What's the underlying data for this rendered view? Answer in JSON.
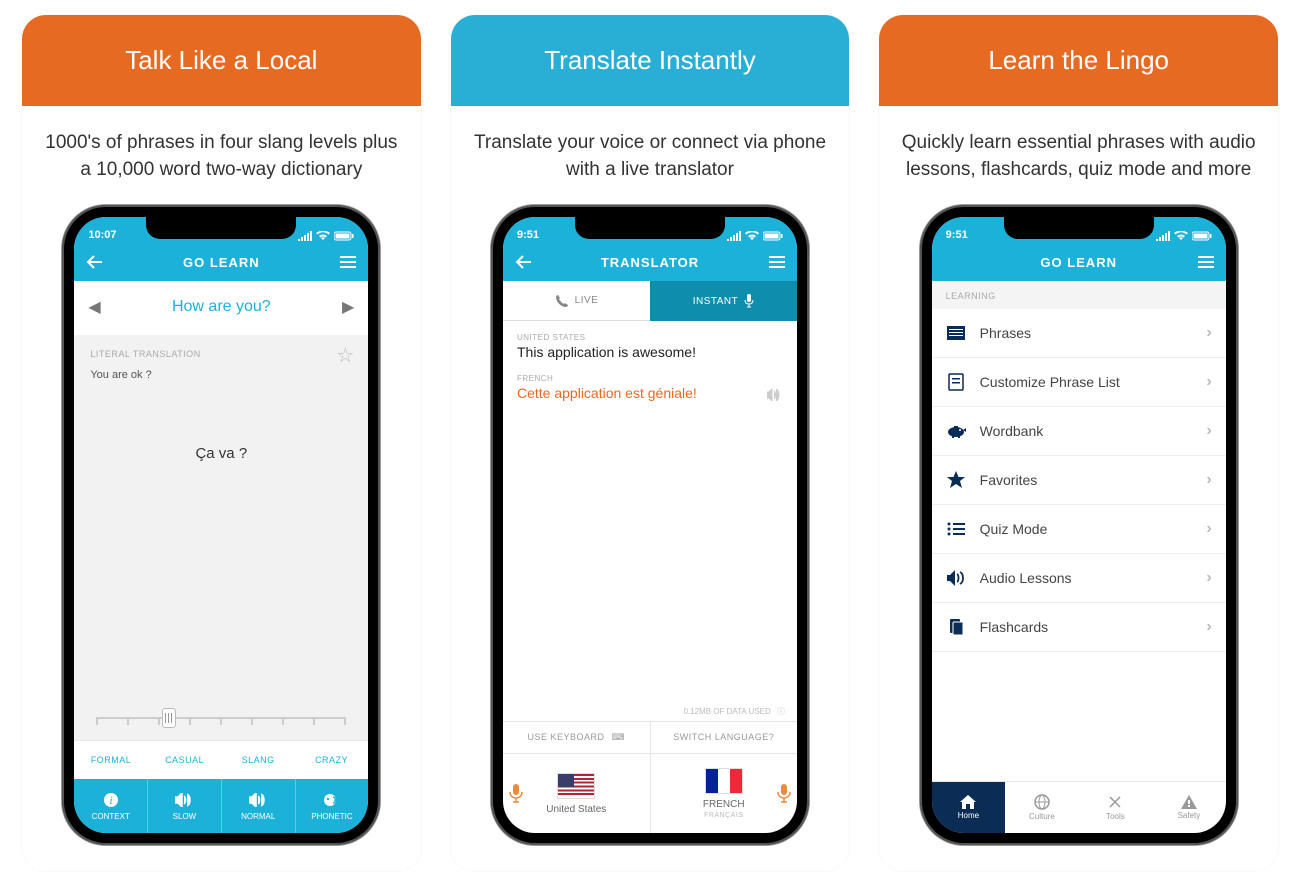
{
  "cards": [
    {
      "title": "Talk Like a Local",
      "subtitle": "1000's of phrases in four slang levels plus a 10,000 word two-way dictionary",
      "header_color": "orange"
    },
    {
      "title": "Translate Instantly",
      "subtitle": "Translate your voice or connect via phone with a live translator",
      "header_color": "teal"
    },
    {
      "title": "Learn the Lingo",
      "subtitle": "Quickly learn essential phrases with audio lessons, flashcards, quiz mode and more",
      "header_color": "orange"
    }
  ],
  "screen1": {
    "time": "10:07",
    "nav_title": "GO LEARN",
    "phrase": "How are you?",
    "literal_label": "LITERAL TRANSLATION",
    "literal_text": "You are ok ?",
    "main_phrase": "Ça va ?",
    "slang_levels": [
      "FORMAL",
      "CASUAL",
      "SLANG",
      "CRAZY"
    ],
    "actions": [
      "CONTEXT",
      "SLOW",
      "NORMAL",
      "PHONETIC"
    ]
  },
  "screen2": {
    "time": "9:51",
    "nav_title": "TRANSLATOR",
    "tab_live": "LIVE",
    "tab_instant": "INSTANT",
    "src_label": "UNITED STATES",
    "src_text": "This application is awesome!",
    "dst_label": "FRENCH",
    "dst_text": "Cette application est géniale!",
    "data_used": "0.12MB OF DATA USED",
    "use_keyboard": "USE KEYBOARD",
    "switch_language": "SWITCH LANGUAGE?",
    "lang1": "United States",
    "lang2": "FRENCH",
    "lang2_sub": "FRANÇAIS"
  },
  "screen3": {
    "time": "9:51",
    "nav_title": "GO LEARN",
    "section": "LEARNING",
    "items": [
      {
        "label": "Phrases"
      },
      {
        "label": "Customize Phrase List"
      },
      {
        "label": "Wordbank"
      },
      {
        "label": "Favorites"
      },
      {
        "label": "Quiz Mode"
      },
      {
        "label": "Audio Lessons"
      },
      {
        "label": "Flashcards"
      }
    ],
    "tabs": [
      "Home",
      "Culture",
      "Tools",
      "Safety"
    ]
  }
}
